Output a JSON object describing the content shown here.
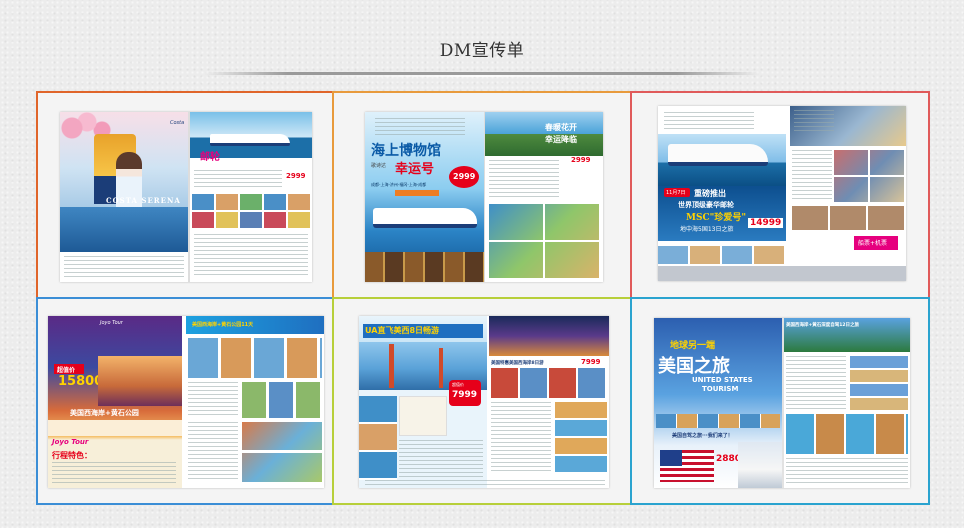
{
  "page": {
    "title": "DM宣传单"
  },
  "colors": {
    "background": "#ececec",
    "frame_1": "#e0652a",
    "frame_2": "#e89a3c",
    "frame_3": "#e05a5a",
    "frame_4": "#3b8ed6",
    "frame_5": "#b7cf3a",
    "frame_6": "#2aa3cf"
  },
  "thumbnails": [
    {
      "name": "Costa Serena flyer",
      "texts": {
        "ship_name": "COSTA SERENA",
        "brand": "Costa",
        "price": "2999",
        "headline": "邮轮"
      }
    },
    {
      "name": "幸运号 flyer",
      "texts": {
        "main_title": "海上博物馆",
        "sub_title": "幸运号",
        "side_label": "歌诗达",
        "route": "成都-上海-济州-福冈-上海-成都",
        "price_left": "2999",
        "price_right": "2999",
        "right_title_1": "春暖花开",
        "right_title_2": "幸运降临"
      }
    },
    {
      "name": "MSC 珍爱号 flyer",
      "texts": {
        "headline": "重磅推出",
        "line2": "世界顶级豪华邮轮",
        "line3": "MSC\"珍爱号\"",
        "line4": "地中海5国13日之旅",
        "price": "14999",
        "badge": "11月7日",
        "right_bottom": "船票+机票"
      }
    },
    {
      "name": "美国西海岸+黄石公园 flyer",
      "texts": {
        "brand": "Joyo Tour",
        "title": "美国西海岸+黄石公园",
        "price": "15800",
        "price_tag": "起",
        "promo": "超值价",
        "bottom_title": "行程特色：",
        "right_header": "美国西海岸+黄石公园11天"
      }
    },
    {
      "name": "美西8日游 flyer",
      "texts": {
        "title": "UA直飞美西8日畅游",
        "price": "7999",
        "price_right": "7999",
        "right_header": "美国特惠美国西海岸8日游",
        "label": "超值价"
      }
    },
    {
      "name": "美国之旅 flyer",
      "texts": {
        "slogan": "地球另一端",
        "title": "美国之旅",
        "english_1": "UNITED STATES",
        "english_2": "TOURISM",
        "question": "美国自驾之旅···我们来了！",
        "price": "28800",
        "right_header": "美国西海岸+黄石深度自驾12日之旅"
      }
    }
  ]
}
